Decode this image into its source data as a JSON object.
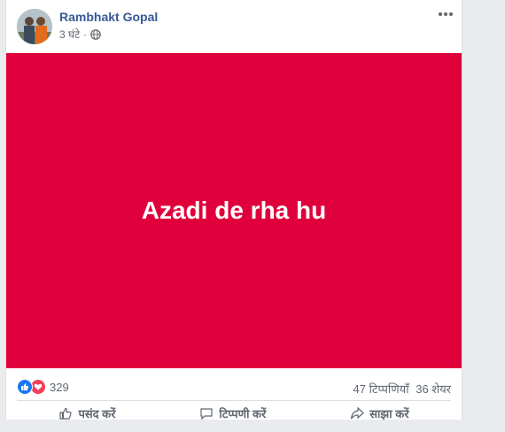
{
  "post": {
    "author": "Rambhakt Gopal",
    "time": "3 घंटे",
    "privacy_icon": "globe-icon",
    "options_icon": "more-options-icon",
    "content_text": "Azadi de rha hu",
    "background_color": "#e0003b"
  },
  "stats": {
    "reactions_count": "329",
    "reaction_icons": [
      "like-icon",
      "love-icon"
    ],
    "comments": "47 टिप्पणियाँ",
    "shares": "36 शेयर"
  },
  "actions": [
    {
      "label": "पसंद करें",
      "icon": "like-outline-icon"
    },
    {
      "label": "टिप्पणी करें",
      "icon": "comment-icon"
    },
    {
      "label": "साझा करें",
      "icon": "share-icon"
    }
  ],
  "colors": {
    "link_blue": "#385898",
    "page_bg": "#e9ebee",
    "like_blue": "#1877f2",
    "love_red": "#f33e58"
  }
}
